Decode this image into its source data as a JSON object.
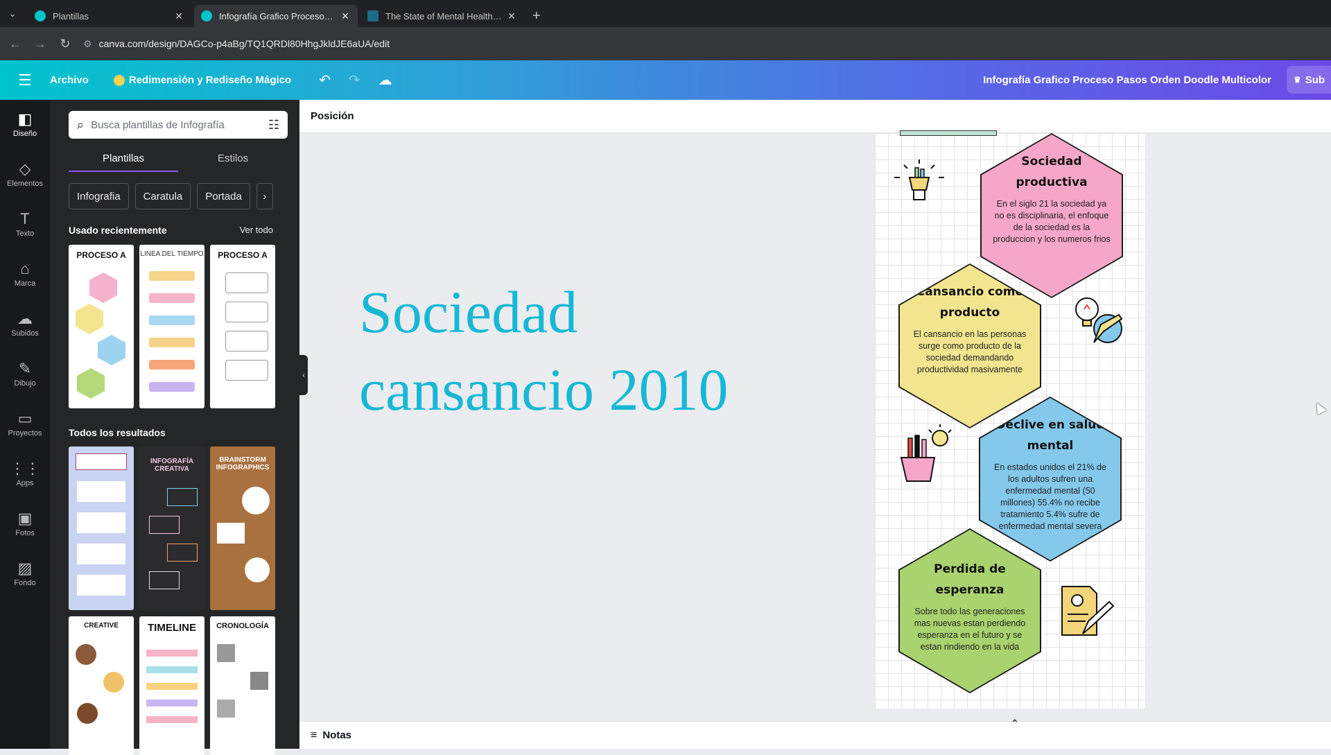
{
  "browser": {
    "tabs": [
      {
        "title": "Plantillas",
        "active": false,
        "favicon_color": "#00c4cc"
      },
      {
        "title": "Infografía Grafico Proceso Pasos",
        "active": true,
        "favicon_color": "#00c4cc"
      },
      {
        "title": "The State of Mental Health in Am",
        "active": false,
        "favicon_color": "#1b6b8a"
      }
    ],
    "url": "canva.com/design/DAGCo-p4aBg/TQ1QRDl80HhgJkldJE6aUA/edit"
  },
  "header": {
    "menu_icon": "hamburger-icon",
    "file_label": "Archivo",
    "magic_label": "Redimensión y Rediseño Mágico",
    "doc_title": "Infografía Grafico Proceso Pasos Orden Doodle Multicolor",
    "share_label": "Sub"
  },
  "rail": [
    {
      "label": "Diseño",
      "icon": "layout-icon",
      "glyph": "◧"
    },
    {
      "label": "Elementos",
      "icon": "shapes-icon",
      "glyph": "◇"
    },
    {
      "label": "Texto",
      "icon": "text-icon",
      "glyph": "T"
    },
    {
      "label": "Marca",
      "icon": "brand-icon",
      "glyph": "⌂"
    },
    {
      "label": "Subidos",
      "icon": "cloud-upload-icon",
      "glyph": "☁"
    },
    {
      "label": "Dibujo",
      "icon": "pen-icon",
      "glyph": "✎"
    },
    {
      "label": "Proyectos",
      "icon": "folder-icon",
      "glyph": "▭"
    },
    {
      "label": "Apps",
      "icon": "apps-icon",
      "glyph": "⋮⋮"
    },
    {
      "label": "Fotos",
      "icon": "photo-icon",
      "glyph": "▣"
    },
    {
      "label": "Fondo",
      "icon": "background-icon",
      "glyph": "▨"
    }
  ],
  "panel": {
    "search_placeholder": "Busca plantillas de Infografía",
    "tabs": [
      "Plantillas",
      "Estilos"
    ],
    "chips": [
      "Infografia",
      "Caratula",
      "Portada"
    ],
    "recent_heading": "Usado recientemente",
    "see_all": "Ver todo",
    "all_heading": "Todos los resultados",
    "recent_thumbs": [
      {
        "title": "PROCESO A",
        "bg": "#ffffff",
        "fg": "#111111"
      },
      {
        "title": "LINEA DEL TIEMPO",
        "bg": "#ffffff",
        "fg": "#333333"
      },
      {
        "title": "PROCESO A",
        "bg": "#ffffff",
        "fg": "#111111"
      }
    ],
    "result_thumbs": [
      {
        "title": "",
        "bg": "#c9d3f2",
        "fg": "#b03a6a"
      },
      {
        "title": "INFOGRAFÍA CREATIVA",
        "bg": "#2b2b2e",
        "fg": "#f0c7e0"
      },
      {
        "title": "BRAINSTORM INFOGRAPHICS",
        "bg": "#a9713f",
        "fg": "#ffffff"
      },
      {
        "title": "CREATIVE",
        "bg": "#ffffff",
        "fg": "#111111"
      },
      {
        "title": "TIMELINE",
        "bg": "#ffffff",
        "fg": "#111111"
      },
      {
        "title": "CRONOLOGÍA",
        "bg": "#ffffff",
        "fg": "#111111"
      }
    ]
  },
  "toolbar": {
    "position_label": "Posición"
  },
  "canvas": {
    "title": "Sociedad cansancio 2010",
    "title_color": "#17b8d6",
    "hexagons": [
      {
        "heading": "Sociedad productiva",
        "body": "En el siglo 21 la sociedad ya no es disciplinaria, el enfoque de la sociedad es la produccion y los numeros frios",
        "color": "#f6a7c9"
      },
      {
        "heading": "Cansancio como producto",
        "body": "El cansancio en las personas surge como producto de la sociedad demandando productividad masivamente",
        "color": "#f3e58f"
      },
      {
        "heading": "Declive en salud mental",
        "body": "En estados unidos el 21% de los adultos sufren una enfermedad mental (50 millones) 55.4% no recibe tratamiento 5.4% sufre de enfermedad mental severa",
        "color": "#84c9ec"
      },
      {
        "heading": "Perdida de esperanza",
        "body": "Sobre todo las generaciones mas nuevas estan perdiendo esperanza en el futuro y se estan rindiendo en la vida",
        "color": "#a9d36e"
      }
    ]
  },
  "notes": {
    "label": "Notas"
  }
}
